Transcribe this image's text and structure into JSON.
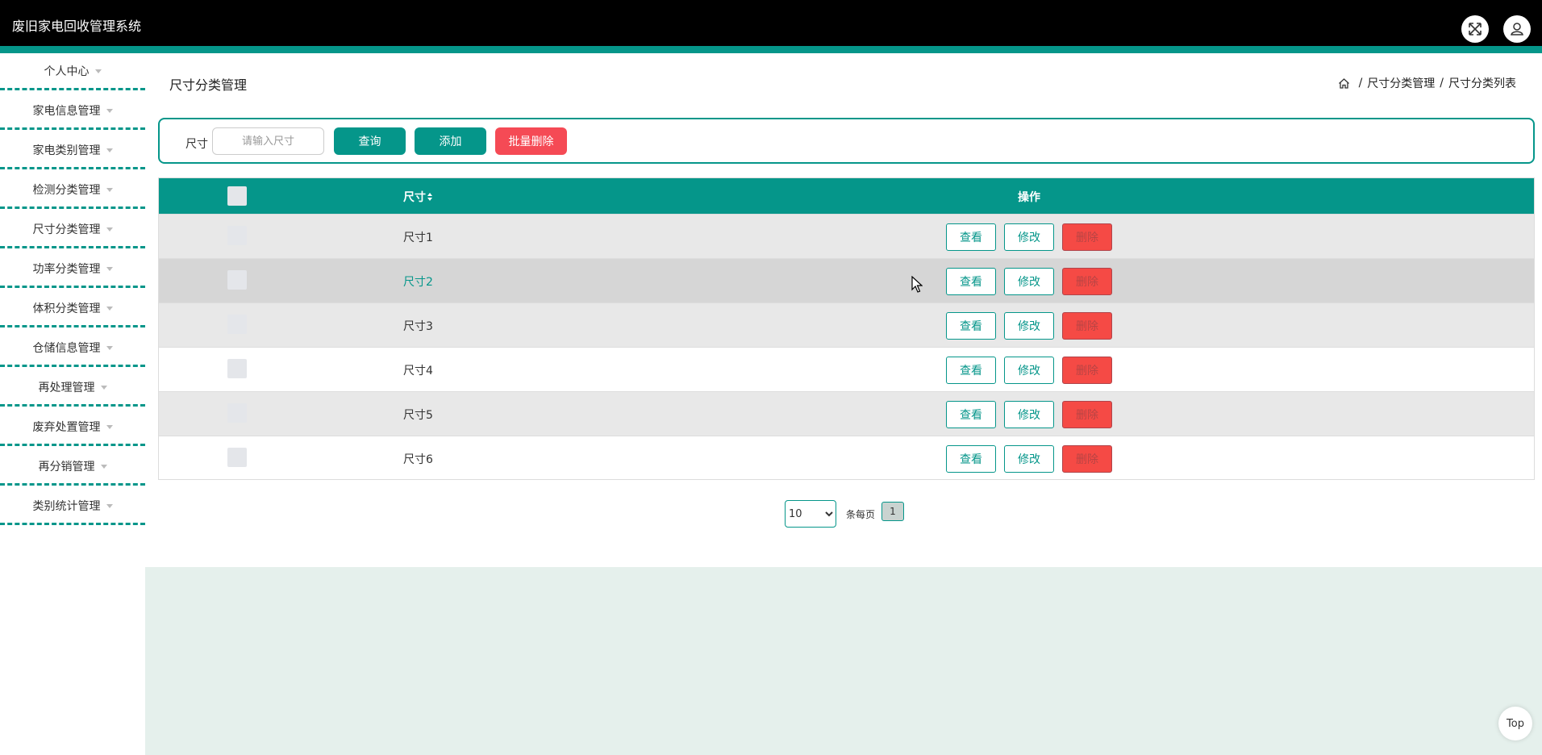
{
  "app": {
    "title": "废旧家电回收管理系统"
  },
  "colors": {
    "accent": "#05968a",
    "danger": "#f54a55",
    "header_bg": "#000000"
  },
  "header": {
    "fullscreen_icon": "fullscreen-icon",
    "user_icon": "user-icon"
  },
  "sidebar": {
    "items": [
      {
        "label": "个人中心"
      },
      {
        "label": "家电信息管理"
      },
      {
        "label": "家电类别管理"
      },
      {
        "label": "检测分类管理"
      },
      {
        "label": "尺寸分类管理"
      },
      {
        "label": "功率分类管理"
      },
      {
        "label": "体积分类管理"
      },
      {
        "label": "仓储信息管理"
      },
      {
        "label": "再处理管理"
      },
      {
        "label": "废弃处置管理"
      },
      {
        "label": "再分销管理"
      },
      {
        "label": "类别统计管理"
      }
    ]
  },
  "page": {
    "title": "尺寸分类管理"
  },
  "breadcrumb": {
    "home_icon": "home-icon",
    "sep": "/",
    "level1": "尺寸分类管理",
    "level2": "尺寸分类列表"
  },
  "search": {
    "label": "尺寸",
    "placeholder": "请输入尺寸",
    "value": "",
    "query_label": "查询",
    "add_label": "添加",
    "batch_delete_label": "批量删除"
  },
  "table": {
    "columns": {
      "name": "尺寸",
      "sort_icon": "sort-icon",
      "actions": "操作"
    },
    "action_labels": {
      "view": "查看",
      "edit": "修改",
      "delete": "删除"
    },
    "rows": [
      {
        "name": "尺寸1"
      },
      {
        "name": "尺寸2"
      },
      {
        "name": "尺寸3"
      },
      {
        "name": "尺寸4"
      },
      {
        "name": "尺寸5"
      },
      {
        "name": "尺寸6"
      }
    ]
  },
  "pagination": {
    "page_size": "10",
    "page_size_options": [
      "10"
    ],
    "per_page_label": "条每页",
    "current_page": "1"
  },
  "back_to_top": {
    "label": "Top"
  }
}
